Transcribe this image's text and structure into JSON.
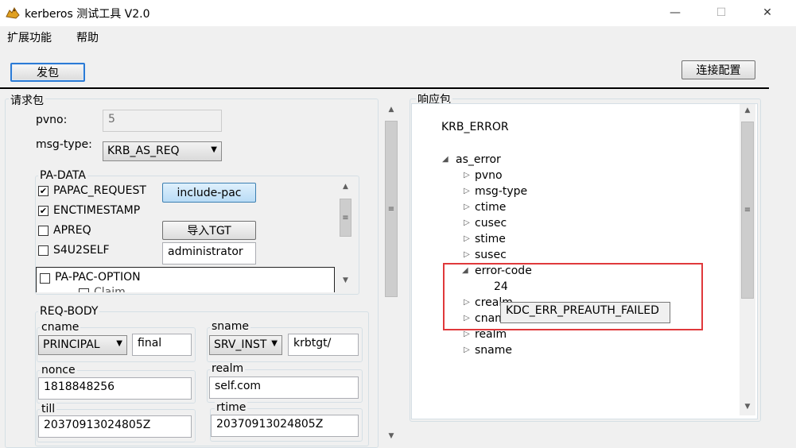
{
  "window": {
    "title": "kerberos 测试工具 V2.0",
    "minimize_glyph": "—",
    "maximize_glyph": "☐",
    "close_glyph": "✕"
  },
  "menu": {
    "items": [
      "扩展功能",
      "帮助"
    ]
  },
  "toolbar": {
    "send_label": "发包",
    "connect_config_label": "连接配置"
  },
  "request": {
    "title": "请求包",
    "pvno_label": "pvno:",
    "pvno_value": "5",
    "msgtype_label": "msg-type:",
    "msgtype_value": "KRB_AS_REQ",
    "padata": {
      "title": "PA-DATA",
      "items": [
        {
          "label": "PAPAC_REQUEST",
          "checked": true
        },
        {
          "label": "ENCTIMESTAMP",
          "checked": true
        },
        {
          "label": "APREQ",
          "checked": false
        },
        {
          "label": "S4U2SELF",
          "checked": false
        }
      ],
      "include_pac_label": "include-pac",
      "import_tgt_label": "导入TGT",
      "s4u_user_value": "administrator",
      "pac_option_label": "PA-PAC-OPTION",
      "claim_label": "Claim"
    },
    "reqbody": {
      "title": "REQ-BODY",
      "cname_label": "cname",
      "cname_type": "PRINCIPAL",
      "cname_value": "final",
      "sname_label": "sname",
      "sname_type": "SRV_INST",
      "sname_value": "krbtgt/",
      "nonce_label": "nonce",
      "nonce_value": "1818848256",
      "realm_label": "realm",
      "realm_value": "self.com",
      "till_label": "till",
      "till_value": "20370913024805Z",
      "rtime_label": "rtime",
      "rtime_value": "20370913024805Z"
    }
  },
  "response": {
    "title": "响应包",
    "root": "KRB_ERROR",
    "node": "as_error",
    "children": [
      "pvno",
      "msg-type",
      "ctime",
      "cusec",
      "stime",
      "susec"
    ],
    "error_code_label": "error-code",
    "error_code_value": "24",
    "after": [
      "crealm",
      "cname",
      "realm",
      "sname"
    ],
    "tooltip": "KDC_ERR_PREAUTH_FAILED"
  },
  "colors": {
    "highlight": "#e0393b",
    "accent_button": "#2b7bd6"
  }
}
